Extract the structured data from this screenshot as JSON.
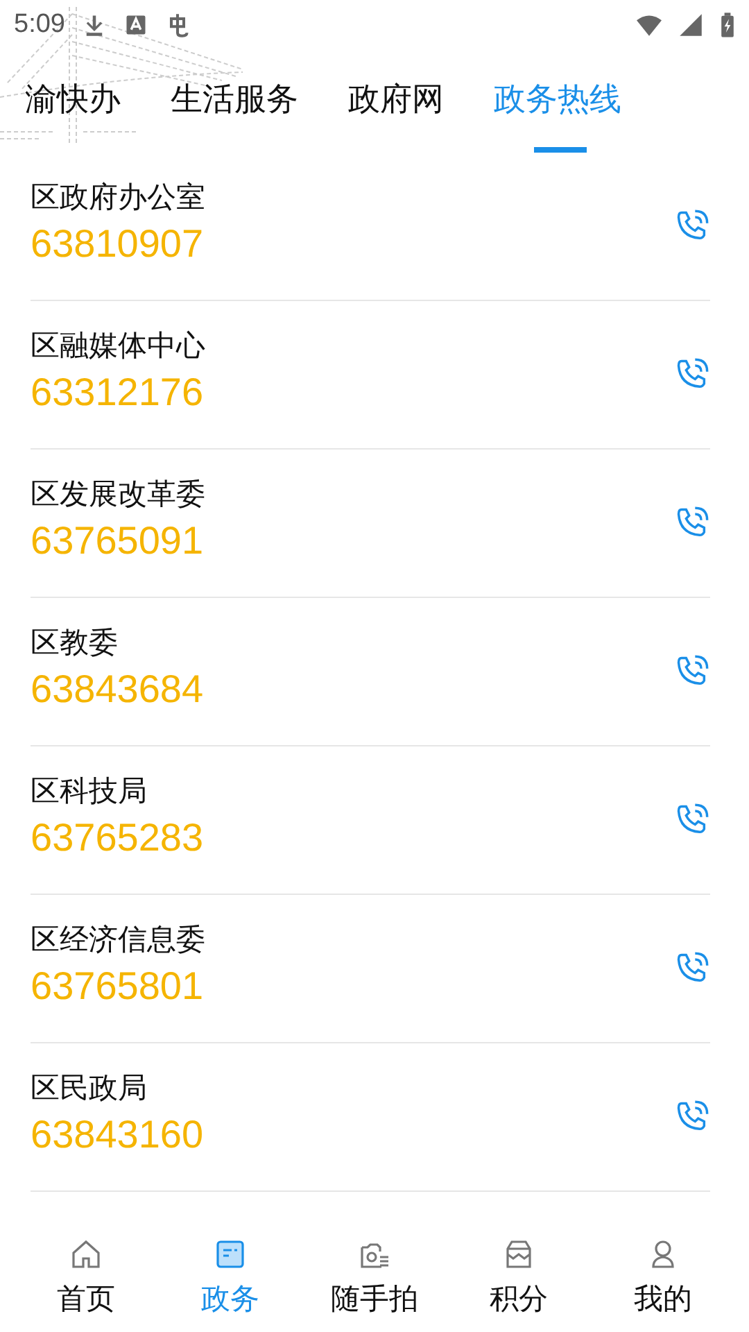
{
  "status_bar": {
    "time": "5:09"
  },
  "tabs": [
    {
      "label": "渝快办",
      "selected": false
    },
    {
      "label": "生活服务",
      "selected": false
    },
    {
      "label": "政府网",
      "selected": false
    },
    {
      "label": "政务热线",
      "selected": true
    }
  ],
  "hotlines": [
    {
      "name": "区政府办公室",
      "phone": "63810907"
    },
    {
      "name": "区融媒体中心",
      "phone": "63312176"
    },
    {
      "name": "区发展改革委",
      "phone": "63765091"
    },
    {
      "name": "区教委",
      "phone": "63843684"
    },
    {
      "name": "区科技局",
      "phone": "63765283"
    },
    {
      "name": "区经济信息委",
      "phone": "63765801"
    },
    {
      "name": "区民政局",
      "phone": "63843160"
    }
  ],
  "bottom_nav": [
    {
      "label": "首页",
      "kind": "home",
      "selected": false
    },
    {
      "label": "政务",
      "kind": "doc",
      "selected": true
    },
    {
      "label": "随手拍",
      "kind": "camera",
      "selected": false
    },
    {
      "label": "积分",
      "kind": "store",
      "selected": false
    },
    {
      "label": "我的",
      "kind": "user",
      "selected": false
    }
  ]
}
